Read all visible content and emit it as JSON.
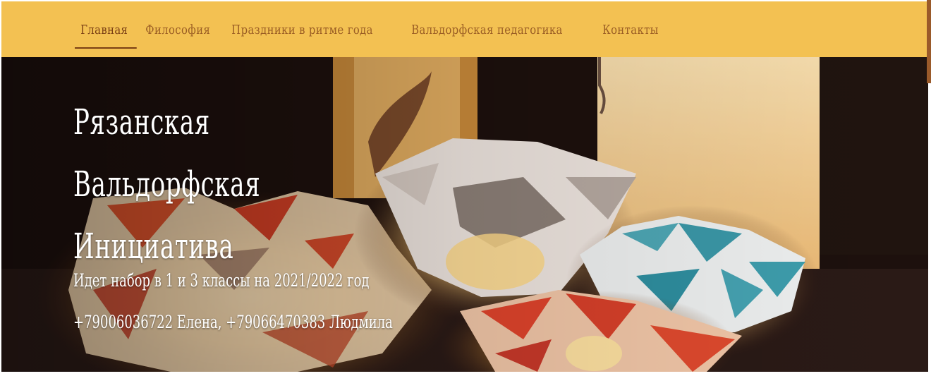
{
  "nav": {
    "items": [
      {
        "label": "Главная",
        "active": true
      },
      {
        "label": "Философия",
        "active": false
      },
      {
        "label": "Праздники в ритме года",
        "active": false
      },
      {
        "label": "Вальдорфская педагогика",
        "active": false
      },
      {
        "label": "Контакты",
        "active": false
      }
    ]
  },
  "hero": {
    "title_line1": "Рязанская",
    "title_line2": "Вальдорфская",
    "title_line3": "Инициатива",
    "subtitle": "Идет набор в 1 и 3 классы на 2021/2022 год",
    "contacts": "+79006036722 Елена, +79066470383 Людмила"
  },
  "colors": {
    "nav_bg": "#f3c152",
    "nav_text": "#9a5d24",
    "nav_active": "#7a3f14",
    "hero_bg": "#1a0f0d"
  }
}
